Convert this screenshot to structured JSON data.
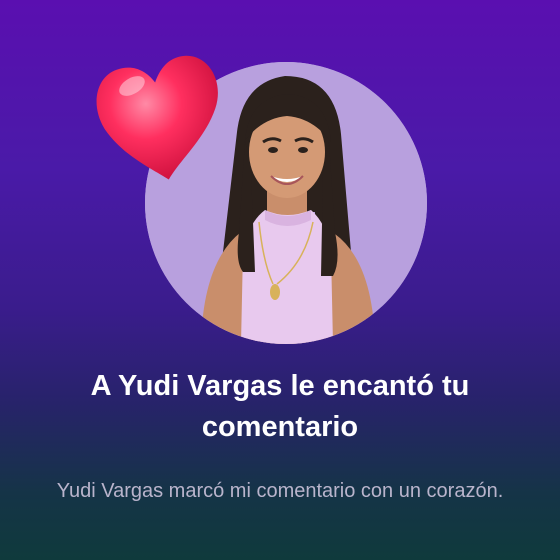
{
  "notification": {
    "title": "A Yudi Vargas le encantó tu comentario",
    "message": "Yudi Vargas marcó mi comentario con un corazón.",
    "avatar": {
      "icon": "profile-photo-avatar",
      "background": "#b8a0de"
    },
    "reaction": {
      "icon": "heart-icon",
      "color": "#ff2f5f"
    }
  },
  "colors": {
    "background_top": "#5a0fb0",
    "background_bottom": "#0f3a3c",
    "title": "#ffffff",
    "subtitle": "#b9b4cc"
  }
}
